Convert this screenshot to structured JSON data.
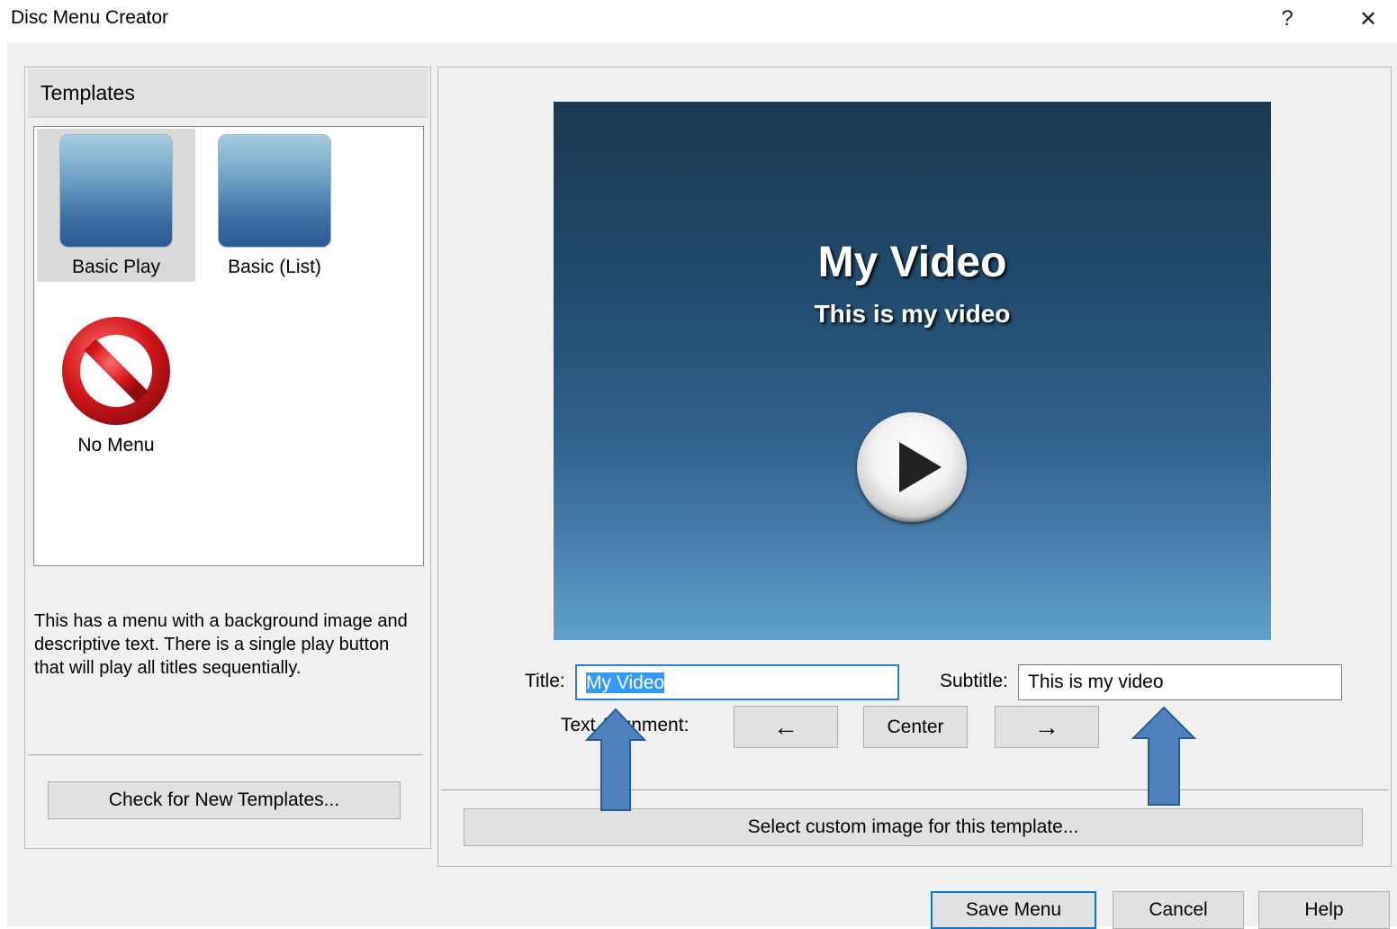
{
  "window": {
    "title": "Disc Menu Creator",
    "help_glyph": "?",
    "close_glyph": "✕"
  },
  "templates": {
    "header": "Templates",
    "items": [
      {
        "label": "Basic Play",
        "selected": true,
        "icon": "gradient-thumbnail"
      },
      {
        "label": "Basic (List)",
        "selected": false,
        "icon": "gradient-thumbnail"
      },
      {
        "label": "No Menu",
        "selected": false,
        "icon": "no-menu-icon"
      }
    ],
    "description": "This has a menu with a background image and descriptive text. There is a single play button that will play all titles sequentially.",
    "check_button": "Check for New Templates..."
  },
  "preview": {
    "title": "My Video",
    "subtitle": "This is my video",
    "play_icon": "play-icon"
  },
  "form": {
    "title_label": "Title:",
    "title_value": "My Video",
    "subtitle_label": "Subtitle:",
    "subtitle_value": "This is my video",
    "alignment_label": "Text Alignment:",
    "align_left": "←",
    "align_center": "Center",
    "align_right": "→",
    "custom_image_button": "Select custom image for this template..."
  },
  "footer": {
    "save": "Save Menu",
    "cancel": "Cancel",
    "help": "Help"
  },
  "colors": {
    "annotation_arrow": "#4f81bd",
    "selection_highlight": "#3399ff",
    "no_menu_red": "#d0161b"
  }
}
